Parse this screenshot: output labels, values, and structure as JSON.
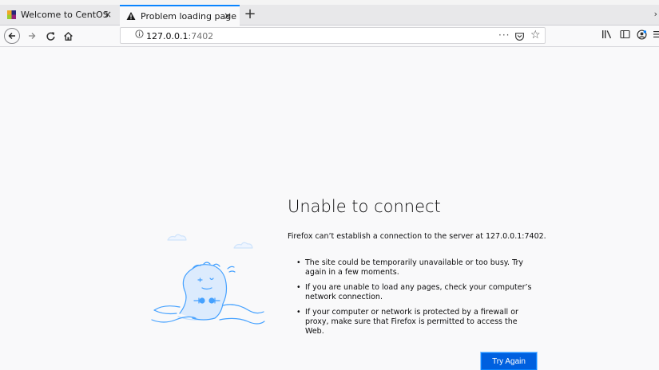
{
  "tabs": [
    {
      "label": "Welcome to CentOS",
      "icon": "centos-logo-icon",
      "active": false
    },
    {
      "label": "Problem loading page",
      "icon": "warning-icon",
      "active": true
    }
  ],
  "tab_close_glyph": "×",
  "new_tab_glyph": "+",
  "tab_scroll_glyph": "›",
  "url": {
    "host": "127.0.0.1",
    "port": ":7402"
  },
  "page": {
    "title": "Unable to connect",
    "description": "Firefox can’t establish a connection to the server at 127.0.0.1:7402.",
    "bullets": [
      "The site could be temporarily unavailable or too busy. Try again in a few moments.",
      "If you are unable to load any pages, check your computer’s network connection.",
      "If your computer or network is protected by a firewall or proxy, make sure that Firefox is permitted to access the Web."
    ],
    "try_again": "Try Again"
  },
  "colors": {
    "accent": "#0a84ff",
    "button": "#0060df",
    "illustration": "#45a1ff"
  }
}
